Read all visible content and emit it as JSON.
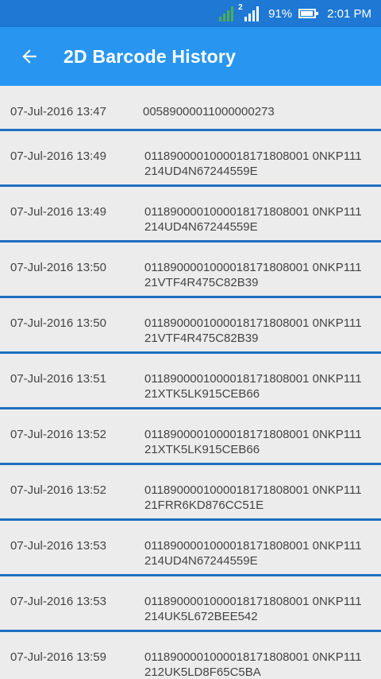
{
  "status": {
    "sim2_label": "2",
    "battery": "91%",
    "time": "2:01 PM"
  },
  "appbar": {
    "title": "2D Barcode History"
  },
  "history": [
    {
      "date": "07-Jul-2016 13:47",
      "code": "00589000011000000273"
    },
    {
      "date": "07-Jul-2016 13:49",
      "code": " 0118900001000018171808001 0NKP111 214UD4N67244559E"
    },
    {
      "date": "07-Jul-2016 13:49",
      "code": " 0118900001000018171808001 0NKP111 214UD4N67244559E"
    },
    {
      "date": "07-Jul-2016 13:50",
      "code": " 0118900001000018171808001 0NKP111 21VTF4R475C82B39"
    },
    {
      "date": "07-Jul-2016 13:50",
      "code": " 0118900001000018171808001 0NKP111 21VTF4R475C82B39"
    },
    {
      "date": "07-Jul-2016 13:51",
      "code": " 0118900001000018171808001 0NKP111 21XTK5LK915CEB66"
    },
    {
      "date": "07-Jul-2016 13:52",
      "code": " 0118900001000018171808001 0NKP111 21XTK5LK915CEB66"
    },
    {
      "date": "07-Jul-2016 13:52",
      "code": " 0118900001000018171808001 0NKP111 21FRR6KD876CC51E"
    },
    {
      "date": "07-Jul-2016 13:53",
      "code": " 0118900001000018171808001 0NKP111 214UD4N67244559E"
    },
    {
      "date": "07-Jul-2016 13:53",
      "code": " 0118900001000018171808001 0NKP111 214UK5L672BEE542"
    },
    {
      "date": "07-Jul-2016 13:59",
      "code": " 0118900001000018171808001 0NKP111 212UK5LD8F65C5BA"
    }
  ]
}
